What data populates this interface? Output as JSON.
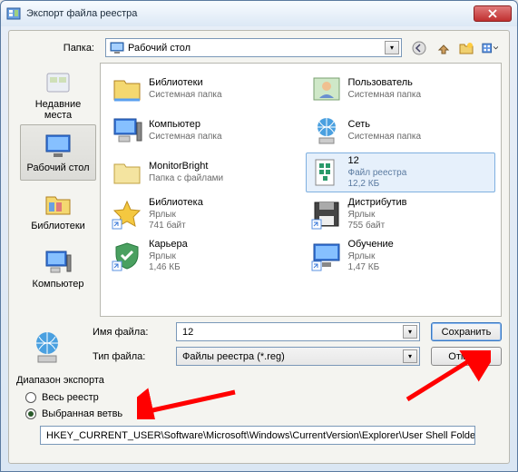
{
  "window": {
    "title": "Экспорт файла реестра"
  },
  "folderRow": {
    "label": "Папка:",
    "value": "Рабочий стол"
  },
  "toolbar": {
    "back": "back",
    "up": "up",
    "newfolder": "newfolder",
    "views": "views"
  },
  "places": [
    {
      "label": "Недавние места"
    },
    {
      "label": "Рабочий стол"
    },
    {
      "label": "Библиотеки"
    },
    {
      "label": "Компьютер"
    }
  ],
  "items": [
    {
      "name": "Библиотеки",
      "sub": "Системная папка",
      "detail": ""
    },
    {
      "name": "Пользователь",
      "sub": "Системная папка",
      "detail": ""
    },
    {
      "name": "Компьютер",
      "sub": "Системная папка",
      "detail": ""
    },
    {
      "name": "Сеть",
      "sub": "Системная папка",
      "detail": ""
    },
    {
      "name": "MonitorBright",
      "sub": "Папка с файлами",
      "detail": ""
    },
    {
      "name": "12",
      "sub": "Файл реестра",
      "detail": "12,2 КБ"
    },
    {
      "name": "Библиотека",
      "sub": "Ярлык",
      "detail": "741 байт"
    },
    {
      "name": "Дистрибутив",
      "sub": "Ярлык",
      "detail": "755 байт"
    },
    {
      "name": "Карьера",
      "sub": "Ярлык",
      "detail": "1,46 КБ"
    },
    {
      "name": "Обучение",
      "sub": "Ярлык",
      "detail": "1,47 КБ"
    }
  ],
  "filename": {
    "label": "Имя файла:",
    "value": "12"
  },
  "filetype": {
    "label": "Тип файла:",
    "value": "Файлы реестра (*.reg)"
  },
  "buttons": {
    "save": "Сохранить",
    "cancel": "Отмена"
  },
  "export": {
    "group": "Диапазон экспорта",
    "whole": "Весь реестр",
    "branch": "Выбранная ветвь",
    "path": "HKEY_CURRENT_USER\\Software\\Microsoft\\Windows\\CurrentVersion\\Explorer\\User Shell Folders"
  }
}
